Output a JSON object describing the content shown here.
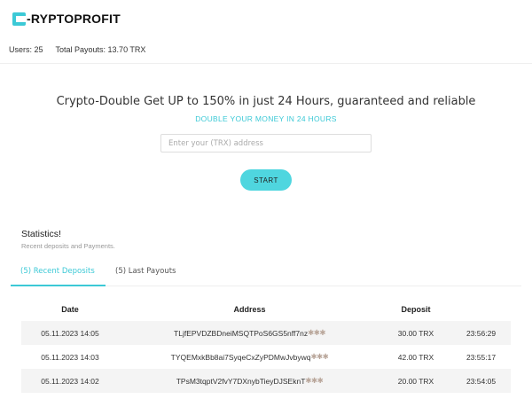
{
  "header": {
    "logo_text": "-RYPTOPROFIT",
    "users_label": "Users: 25",
    "payouts_label": "Total Payouts: 13.70 TRX"
  },
  "hero": {
    "title": "Crypto-Double Get UP to 150% in just 24 Hours, guaranteed and reliable",
    "subtitle": "DOUBLE YOUR MONEY IN 24 HOURS",
    "address_placeholder": "Enter your (TRX) address",
    "start_label": "START"
  },
  "statistics": {
    "title": "Statistics!",
    "description": "Recent deposits and Payments.",
    "tabs": [
      {
        "label": "(5) Recent Deposits",
        "active": true
      },
      {
        "label": "(5) Last Payouts",
        "active": false
      }
    ]
  },
  "table": {
    "headers": [
      "Date",
      "Address",
      "Deposit",
      ""
    ],
    "rows": [
      {
        "date": "05.11.2023 14:05",
        "address": "TLjfEPVDZBDneiMSQTPoS6GS5nff7nz",
        "masked": "✱✱✱",
        "deposit": "30.00 TRX",
        "time": "23:56:29"
      },
      {
        "date": "05.11.2023 14:03",
        "address": "TYQEMxkBb8ai7SyqeCxZyPDMwJvbywq",
        "masked": "✱✱✱",
        "deposit": "42.00 TRX",
        "time": "23:55:17"
      },
      {
        "date": "05.11.2023 14:02",
        "address": "TPsM3tqptV2fvY7DXnybTieyDJSEknT",
        "masked": "✱✱✱",
        "deposit": "20.00 TRX",
        "time": "23:54:05"
      }
    ]
  },
  "colors": {
    "accent": "#3cc9d6",
    "button": "#4fd6df",
    "stripe": "#f4f4f4"
  }
}
